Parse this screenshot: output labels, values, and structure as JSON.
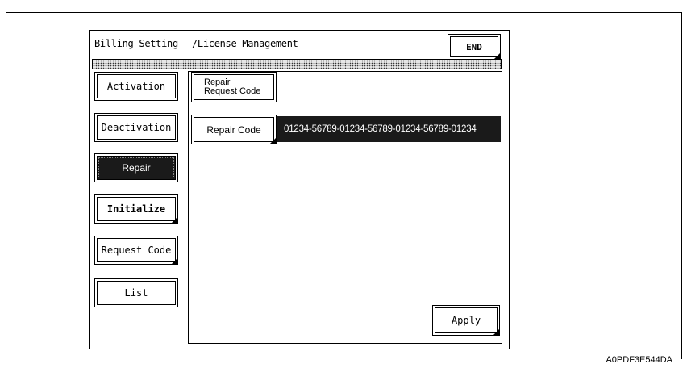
{
  "header": {
    "title_left": "Billing Setting",
    "title_right": "/License Management",
    "end_label": "END"
  },
  "sidebar": {
    "items": [
      {
        "label": "Activation",
        "state": "normal"
      },
      {
        "label": "Deactivation",
        "state": "normal"
      },
      {
        "label": "Repair",
        "state": "selected"
      },
      {
        "label": "Initialize",
        "state": "normal"
      },
      {
        "label": "Request Code",
        "state": "normal"
      },
      {
        "label": "List",
        "state": "normal"
      }
    ]
  },
  "main": {
    "repair_request_code_label_line1": "Repair",
    "repair_request_code_label_line2": "Request Code",
    "repair_code_label": "Repair Code",
    "repair_code_value": "01234-56789-01234-56789-01234-56789-01234",
    "apply_label": "Apply"
  },
  "figure_id": "A0PDF3E544DA",
  "colors": {
    "selected_bg": "#1a1a1a",
    "border": "#000000"
  }
}
